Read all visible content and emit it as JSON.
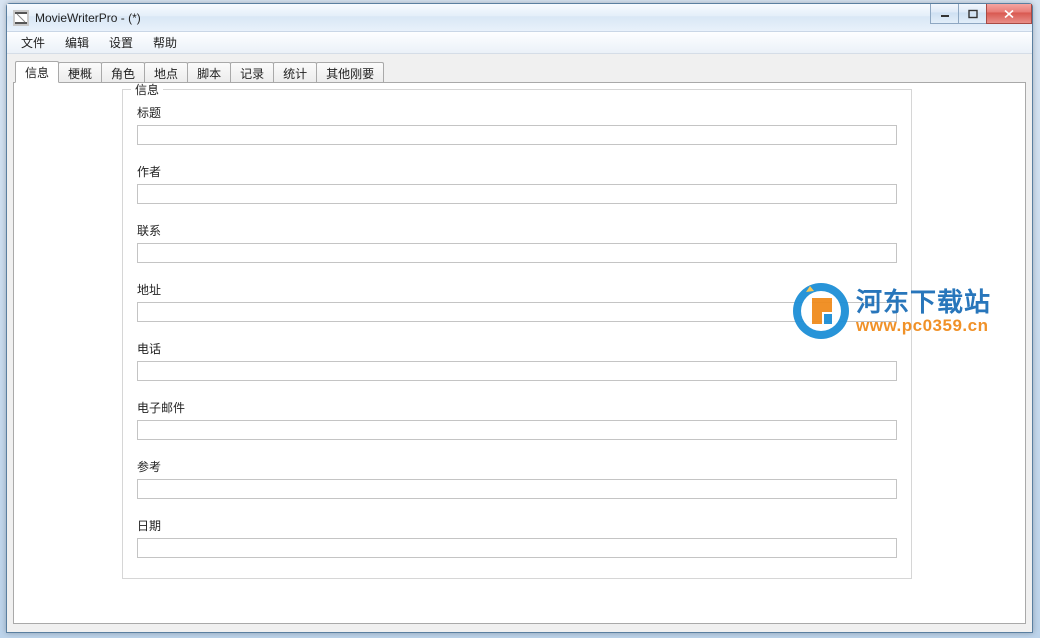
{
  "window": {
    "title": "MovieWriterPro -  (*)"
  },
  "menu": {
    "file": "文件",
    "edit": "编辑",
    "settings": "设置",
    "help": "帮助"
  },
  "tabs": [
    {
      "id": "info",
      "label": "信息",
      "active": true
    },
    {
      "id": "synopsis",
      "label": "梗概",
      "active": false
    },
    {
      "id": "roles",
      "label": "角色",
      "active": false
    },
    {
      "id": "places",
      "label": "地点",
      "active": false
    },
    {
      "id": "script",
      "label": "脚本",
      "active": false
    },
    {
      "id": "log",
      "label": "记录",
      "active": false
    },
    {
      "id": "stats",
      "label": "统计",
      "active": false
    },
    {
      "id": "other",
      "label": "其他刚要",
      "active": false
    }
  ],
  "info_panel": {
    "group_title": "信息",
    "fields": {
      "title": {
        "label": "标题",
        "value": ""
      },
      "author": {
        "label": "作者",
        "value": ""
      },
      "contact": {
        "label": "联系",
        "value": ""
      },
      "address": {
        "label": "地址",
        "value": ""
      },
      "phone": {
        "label": "电话",
        "value": ""
      },
      "email": {
        "label": "电子邮件",
        "value": ""
      },
      "ref": {
        "label": "参考",
        "value": ""
      },
      "date": {
        "label": "日期",
        "value": ""
      }
    }
  },
  "watermark": {
    "line1": "河东下载站",
    "line2": "www.pc0359.cn"
  }
}
